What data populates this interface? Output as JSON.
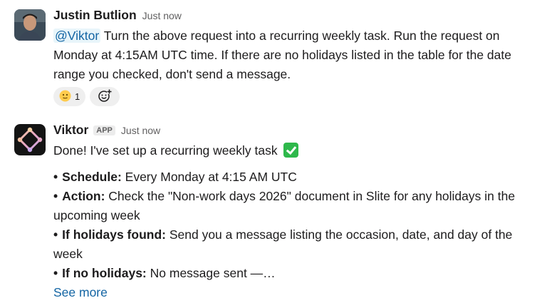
{
  "messages": [
    {
      "author": "Justin Butlion",
      "time": "Just now",
      "mention": "@Viktor",
      "text": " Turn the above request into a recurring weekly task. Run the request on Monday at 4:15AM UTC time. If there are no holidays listed in the table for the date range you checked, don't send a message.",
      "reactions": [
        {
          "emoji": "slightly-smiling-face",
          "count": "1"
        }
      ],
      "add_reaction_icon": "add-reaction-icon"
    },
    {
      "author": "Viktor",
      "badge": "APP",
      "time": "Just now",
      "intro": "Done! I've set up a recurring weekly task",
      "intro_icon": "white-check-mark",
      "bullet": "•",
      "items": [
        {
          "label": "Schedule:",
          "text": " Every Monday at 4:15 AM UTC"
        },
        {
          "label": "Action:",
          "text": " Check the \"Non-work days 2026\" document in Slite for any holidays in the upcoming week"
        },
        {
          "label": "If holidays found:",
          "text": " Send you a message listing the occasion, date, and day of the week"
        },
        {
          "label": "If no holidays:",
          "text": " No message sent —…"
        }
      ],
      "see_more": "See more"
    }
  ],
  "colors": {
    "link": "#1264a3",
    "mention_bg": "#e8f5fa",
    "check": "#2eb84b"
  }
}
